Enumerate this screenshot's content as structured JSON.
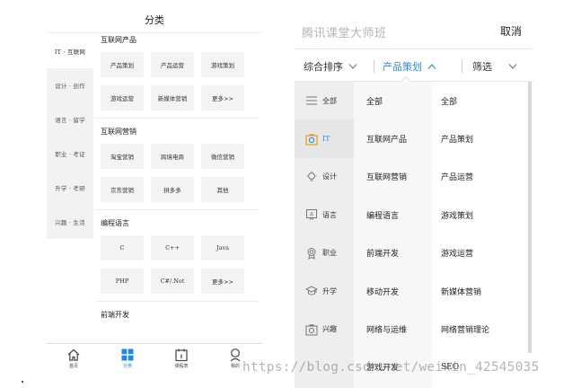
{
  "left": {
    "title": "分类",
    "sidebar": [
      {
        "label": "IT · 互联网",
        "active": true
      },
      {
        "label": "设计 · 创作"
      },
      {
        "label": "语言 · 留学"
      },
      {
        "label": "职业 · 考证"
      },
      {
        "label": "升学 · 考研"
      },
      {
        "label": "兴趣 · 生活"
      }
    ],
    "sections": [
      {
        "title": "互联网产品",
        "items": [
          "产品策划",
          "产品运营",
          "游戏策划",
          "游戏运营",
          "新媒体营销",
          "更多>>"
        ]
      },
      {
        "title": "互联网营销",
        "items": [
          "淘宝营销",
          "跨境电商",
          "微信营销",
          "京东营销",
          "拼多多",
          "其他"
        ]
      },
      {
        "title": "编程语言",
        "items": [
          "C",
          "C++",
          "Java",
          "PHP",
          "C#/.Net",
          "更多>>"
        ]
      },
      {
        "title": "前端开发",
        "items": []
      }
    ],
    "tabbar": [
      {
        "label": "首页",
        "icon": "home-icon"
      },
      {
        "label": "分类",
        "icon": "grid-icon",
        "active": true
      },
      {
        "label": "课程表",
        "icon": "calendar-icon"
      },
      {
        "label": "我的",
        "icon": "profile-icon"
      }
    ]
  },
  "right": {
    "search_placeholder": "腾讯课堂大师班",
    "cancel_label": "取消",
    "filters": [
      {
        "label": "综合排序"
      },
      {
        "label": "产品策划",
        "active": true
      },
      {
        "label": "筛选"
      }
    ],
    "categories": [
      {
        "label": "全部",
        "icon": "menu-icon"
      },
      {
        "label": "IT",
        "icon": "camera-icon",
        "active": true
      },
      {
        "label": "设计",
        "icon": "lightbulb-icon"
      },
      {
        "label": "语言",
        "icon": "language-icon"
      },
      {
        "label": "职业",
        "icon": "badge-icon"
      },
      {
        "label": "升学",
        "icon": "graduation-cap-icon"
      },
      {
        "label": "兴趣",
        "icon": "camera-icon"
      }
    ],
    "subcategories": [
      "全部",
      "互联网产品",
      "互联网营销",
      "编程语言",
      "前端开发",
      "移动开发",
      "网络与运维",
      "游戏开发"
    ],
    "leaves": [
      "全部",
      "产品策划",
      "产品运营",
      "游戏策划",
      "游戏运营",
      "新媒体营销",
      "网络营销理论",
      "SEO"
    ]
  },
  "watermark": "https://blog.csdn.net/weixin_42545035",
  "colors": {
    "accent": "#2b8bd8",
    "tab_active": "#1e88e5"
  }
}
